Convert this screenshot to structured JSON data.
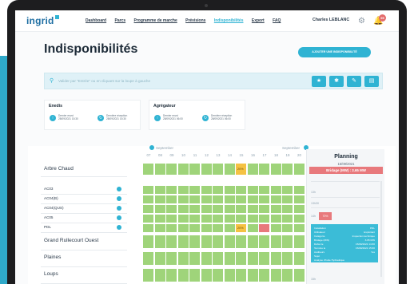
{
  "header": {
    "logo": "ingrid",
    "logo_sub": "",
    "nav": [
      "Dashboard",
      "Parcs",
      "Programme de marche",
      "Prévisions",
      "Indisponibilités",
      "Export",
      "FAQ"
    ],
    "active_nav": 4,
    "user": "Charles LEBLANC",
    "notif_count": "99"
  },
  "page": {
    "title": "Indisponibilités",
    "add_button": "AJOUTER UNE INDISPONIBILITÉ"
  },
  "search": {
    "placeholder": "Valider par \"Entrée\" ou en cliquant sur la loupe à gauche",
    "toolbar": [
      "star-icon",
      "run-icon",
      "wrench-icon",
      "file-icon"
    ]
  },
  "cards": [
    {
      "title": "Enedis",
      "sent_label": "Dernier envoi",
      "sent_date": "28/09/2021 15:30",
      "recv_label": "Dernière réception",
      "recv_date": "28/09/2021 15:30"
    },
    {
      "title": "Agrégateur",
      "sent_label": "Dernier envoi",
      "sent_date": "28/09/2021 06:00",
      "recv_label": "Dernière réception",
      "recv_date": "28/09/2021 06:00"
    }
  ],
  "calendar": {
    "month_left": "September",
    "month_right": "September",
    "days": [
      "07",
      "08",
      "09",
      "10",
      "11",
      "12",
      "13",
      "14",
      "15",
      "16",
      "17",
      "18",
      "19",
      "20"
    ],
    "rows": [
      {
        "label": "Arbre Chaud",
        "type": "park"
      },
      {
        "label": "AC03",
        "type": "sub"
      },
      {
        "label": "AC04(B)",
        "type": "sub"
      },
      {
        "label": "AC04(QUS)",
        "type": "sub"
      },
      {
        "label": "AC05",
        "type": "sub"
      },
      {
        "label": "PDL",
        "type": "sub"
      },
      {
        "label": "Grand Rullecourt Ouest",
        "type": "park"
      },
      {
        "label": "Plaines",
        "type": "park"
      },
      {
        "label": "Loups",
        "type": "park"
      }
    ],
    "highlight_text": "20%"
  },
  "planning": {
    "title": "Planning",
    "date": "15/09/2021",
    "bridage": "Bridage (MW) : 3.65 MW",
    "hours": [
      "13h",
      "13h30",
      "14h",
      "15h"
    ],
    "event_label": "70%",
    "tooltip": [
      [
        "Installation",
        "PDL"
      ],
      [
        "Utilisateur",
        "Exploitant"
      ],
      [
        "Catégorie",
        "Inspection technique"
      ],
      [
        "Bridage (MW)",
        "3.65 MW"
      ],
      [
        "Début le",
        "15/09/2021 14:30"
      ],
      [
        "Termine le",
        "15/09/2021 15:00"
      ],
      [
        "Auditeurs",
        "Yes"
      ],
      [
        "Sujet",
        ""
      ],
      [
        "Analyse d'huile Hydraulique",
        ""
      ]
    ]
  },
  "colors": {
    "accent": "#2fb3d3",
    "green": "#9fd47a",
    "yellow": "#f5c243",
    "red": "#e8797c"
  }
}
